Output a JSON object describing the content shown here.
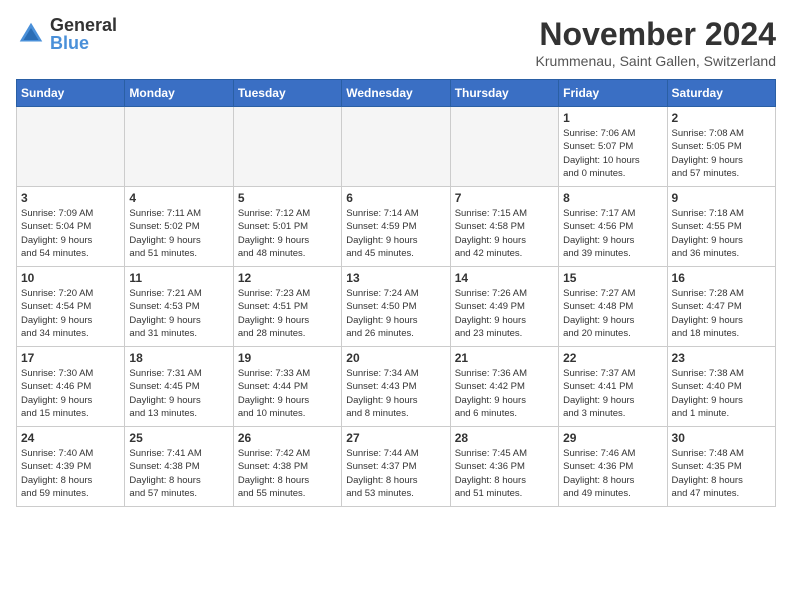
{
  "logo": {
    "general": "General",
    "blue": "Blue"
  },
  "header": {
    "month_year": "November 2024",
    "location": "Krummenau, Saint Gallen, Switzerland"
  },
  "weekdays": [
    "Sunday",
    "Monday",
    "Tuesday",
    "Wednesday",
    "Thursday",
    "Friday",
    "Saturday"
  ],
  "weeks": [
    [
      {
        "day": "",
        "info": "",
        "empty": true
      },
      {
        "day": "",
        "info": "",
        "empty": true
      },
      {
        "day": "",
        "info": "",
        "empty": true
      },
      {
        "day": "",
        "info": "",
        "empty": true
      },
      {
        "day": "",
        "info": "",
        "empty": true
      },
      {
        "day": "1",
        "info": "Sunrise: 7:06 AM\nSunset: 5:07 PM\nDaylight: 10 hours\nand 0 minutes."
      },
      {
        "day": "2",
        "info": "Sunrise: 7:08 AM\nSunset: 5:05 PM\nDaylight: 9 hours\nand 57 minutes."
      }
    ],
    [
      {
        "day": "3",
        "info": "Sunrise: 7:09 AM\nSunset: 5:04 PM\nDaylight: 9 hours\nand 54 minutes."
      },
      {
        "day": "4",
        "info": "Sunrise: 7:11 AM\nSunset: 5:02 PM\nDaylight: 9 hours\nand 51 minutes."
      },
      {
        "day": "5",
        "info": "Sunrise: 7:12 AM\nSunset: 5:01 PM\nDaylight: 9 hours\nand 48 minutes."
      },
      {
        "day": "6",
        "info": "Sunrise: 7:14 AM\nSunset: 4:59 PM\nDaylight: 9 hours\nand 45 minutes."
      },
      {
        "day": "7",
        "info": "Sunrise: 7:15 AM\nSunset: 4:58 PM\nDaylight: 9 hours\nand 42 minutes."
      },
      {
        "day": "8",
        "info": "Sunrise: 7:17 AM\nSunset: 4:56 PM\nDaylight: 9 hours\nand 39 minutes."
      },
      {
        "day": "9",
        "info": "Sunrise: 7:18 AM\nSunset: 4:55 PM\nDaylight: 9 hours\nand 36 minutes."
      }
    ],
    [
      {
        "day": "10",
        "info": "Sunrise: 7:20 AM\nSunset: 4:54 PM\nDaylight: 9 hours\nand 34 minutes."
      },
      {
        "day": "11",
        "info": "Sunrise: 7:21 AM\nSunset: 4:53 PM\nDaylight: 9 hours\nand 31 minutes."
      },
      {
        "day": "12",
        "info": "Sunrise: 7:23 AM\nSunset: 4:51 PM\nDaylight: 9 hours\nand 28 minutes."
      },
      {
        "day": "13",
        "info": "Sunrise: 7:24 AM\nSunset: 4:50 PM\nDaylight: 9 hours\nand 26 minutes."
      },
      {
        "day": "14",
        "info": "Sunrise: 7:26 AM\nSunset: 4:49 PM\nDaylight: 9 hours\nand 23 minutes."
      },
      {
        "day": "15",
        "info": "Sunrise: 7:27 AM\nSunset: 4:48 PM\nDaylight: 9 hours\nand 20 minutes."
      },
      {
        "day": "16",
        "info": "Sunrise: 7:28 AM\nSunset: 4:47 PM\nDaylight: 9 hours\nand 18 minutes."
      }
    ],
    [
      {
        "day": "17",
        "info": "Sunrise: 7:30 AM\nSunset: 4:46 PM\nDaylight: 9 hours\nand 15 minutes."
      },
      {
        "day": "18",
        "info": "Sunrise: 7:31 AM\nSunset: 4:45 PM\nDaylight: 9 hours\nand 13 minutes."
      },
      {
        "day": "19",
        "info": "Sunrise: 7:33 AM\nSunset: 4:44 PM\nDaylight: 9 hours\nand 10 minutes."
      },
      {
        "day": "20",
        "info": "Sunrise: 7:34 AM\nSunset: 4:43 PM\nDaylight: 9 hours\nand 8 minutes."
      },
      {
        "day": "21",
        "info": "Sunrise: 7:36 AM\nSunset: 4:42 PM\nDaylight: 9 hours\nand 6 minutes."
      },
      {
        "day": "22",
        "info": "Sunrise: 7:37 AM\nSunset: 4:41 PM\nDaylight: 9 hours\nand 3 minutes."
      },
      {
        "day": "23",
        "info": "Sunrise: 7:38 AM\nSunset: 4:40 PM\nDaylight: 9 hours\nand 1 minute."
      }
    ],
    [
      {
        "day": "24",
        "info": "Sunrise: 7:40 AM\nSunset: 4:39 PM\nDaylight: 8 hours\nand 59 minutes."
      },
      {
        "day": "25",
        "info": "Sunrise: 7:41 AM\nSunset: 4:38 PM\nDaylight: 8 hours\nand 57 minutes."
      },
      {
        "day": "26",
        "info": "Sunrise: 7:42 AM\nSunset: 4:38 PM\nDaylight: 8 hours\nand 55 minutes."
      },
      {
        "day": "27",
        "info": "Sunrise: 7:44 AM\nSunset: 4:37 PM\nDaylight: 8 hours\nand 53 minutes."
      },
      {
        "day": "28",
        "info": "Sunrise: 7:45 AM\nSunset: 4:36 PM\nDaylight: 8 hours\nand 51 minutes."
      },
      {
        "day": "29",
        "info": "Sunrise: 7:46 AM\nSunset: 4:36 PM\nDaylight: 8 hours\nand 49 minutes."
      },
      {
        "day": "30",
        "info": "Sunrise: 7:48 AM\nSunset: 4:35 PM\nDaylight: 8 hours\nand 47 minutes."
      }
    ]
  ]
}
